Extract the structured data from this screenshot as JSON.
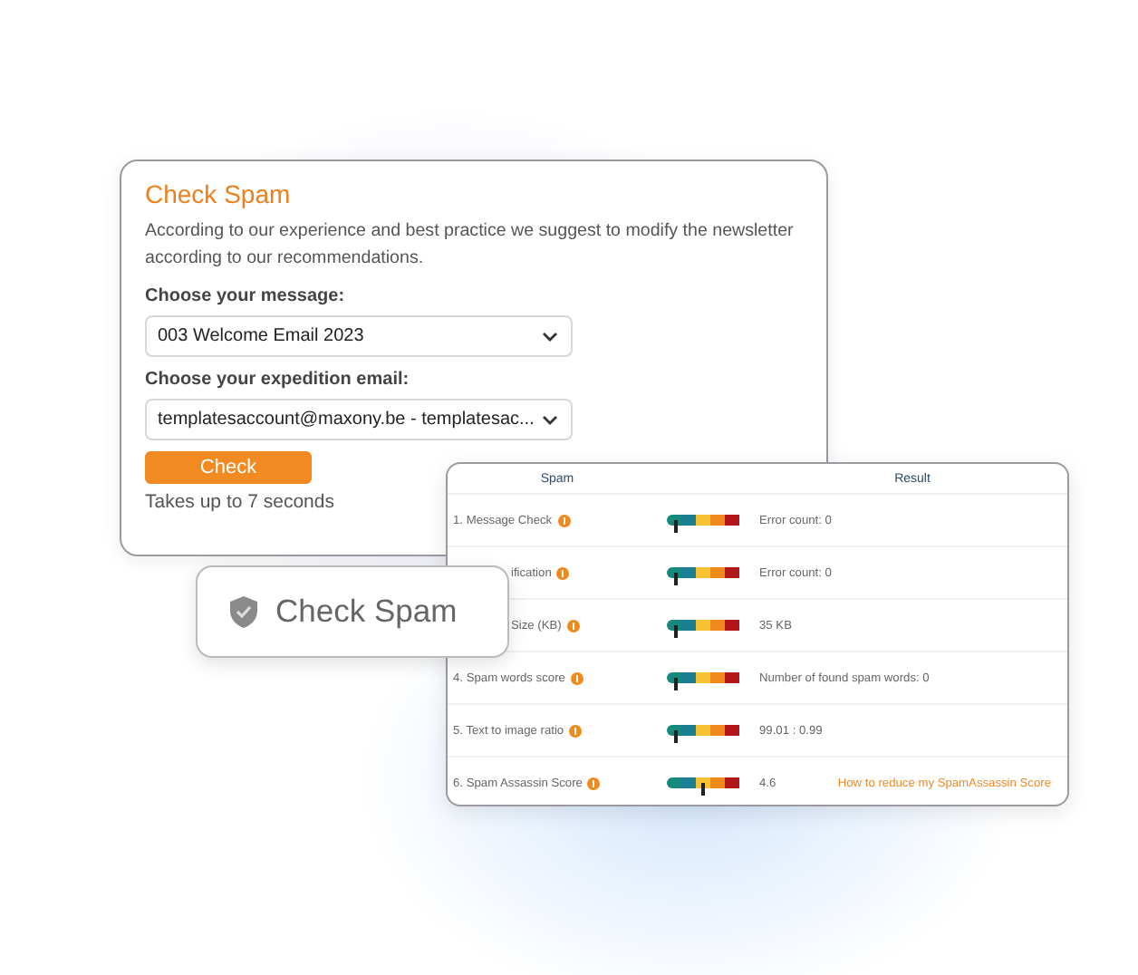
{
  "form": {
    "title": "Check Spam",
    "description": "According to our experience and best practice we suggest to modify the newsletter according to our recommendations.",
    "fields": [
      {
        "label": "Choose your message:",
        "value": "003 Welcome Email 2023"
      },
      {
        "label": "Choose your expedition email:",
        "value": "templatesaccount@maxony.be - templatesac..."
      }
    ],
    "button": "Check",
    "note": "Takes up to 7 seconds"
  },
  "table": {
    "columns": [
      "Spam",
      "Result"
    ],
    "rows": [
      {
        "check": "1. Message Check",
        "level": 0.12,
        "result": "Error count:  0"
      },
      {
        "check": "ification",
        "level": 0.12,
        "result": "Error count:  0"
      },
      {
        "check": "Size (KB)",
        "level": 0.12,
        "result": "35  KB"
      },
      {
        "check": "4. Spam words score",
        "level": 0.12,
        "result": "Number of found spam words:  0"
      },
      {
        "check": "5. Text to image ratio",
        "level": 0.12,
        "result": "99.01 : 0.99"
      },
      {
        "check": "6. Spam Assassin Score",
        "level": 0.5,
        "result": "4.6",
        "link": "How to reduce my SpamAssassin Score"
      }
    ]
  },
  "badge": {
    "label": "Check Spam"
  }
}
